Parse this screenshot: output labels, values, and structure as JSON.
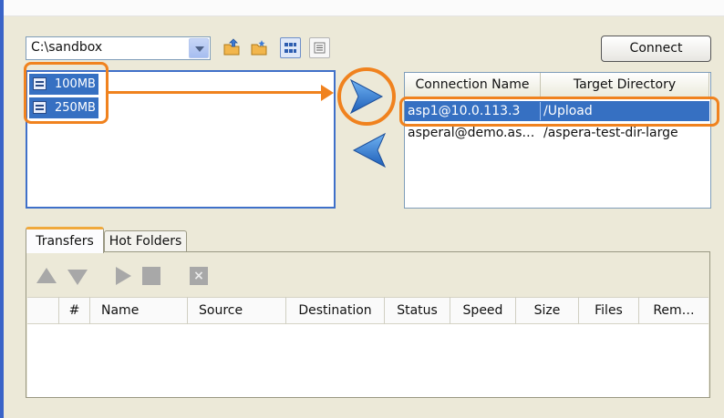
{
  "toolbar": {
    "path_value": "C:\\sandbox",
    "connect_label": "Connect"
  },
  "local_files": [
    {
      "name": "100MB"
    },
    {
      "name": "250MB"
    }
  ],
  "connections": {
    "headers": [
      "Connection Name",
      "Target Directory"
    ],
    "rows": [
      {
        "name": "asp1@10.0.113.3",
        "target": "/Upload",
        "selected": true
      },
      {
        "name": "asperal@demo.as…",
        "target": "/aspera-test-dir-large",
        "selected": false
      }
    ]
  },
  "tabs": [
    "Transfers",
    "Hot Folders"
  ],
  "transfers": {
    "columns": [
      "#",
      "Name",
      "Source",
      "Destination",
      "Status",
      "Speed",
      "Size",
      "Files",
      "Rem…"
    ]
  },
  "colors": {
    "selection": "#3670c2",
    "highlight": "#f0821e",
    "arrow_blue": "#2f78cf"
  },
  "icons": [
    "dropdown-arrow-icon",
    "folder-up-icon",
    "new-folder-icon",
    "thumbnails-view-icon",
    "list-view-icon",
    "file-icon",
    "upload-arrow-icon",
    "download-arrow-icon",
    "move-up-icon",
    "move-down-icon",
    "resume-icon",
    "stop-icon",
    "remove-icon"
  ]
}
